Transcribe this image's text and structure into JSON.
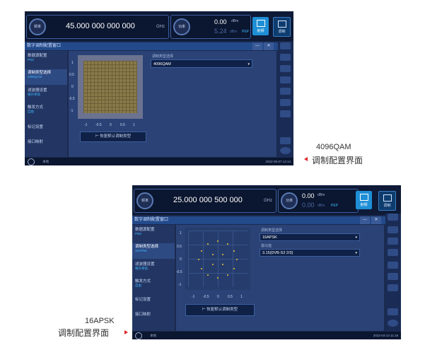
{
  "screen1": {
    "freq_knob": "频率",
    "freq_value": "45.000 000 000 000",
    "freq_unit": "GHz",
    "power_knob": "功率",
    "power_value": "0.00",
    "power_unit": "dBm",
    "power_sub_value": "5.24",
    "power_sub_unit": "dBm",
    "power_sub_tag": "PEP",
    "btn_rf": "射频",
    "btn_mod": "调制",
    "window_title": "数字调制配置窗口",
    "min_btn": "—",
    "close_btn": "✕",
    "sidebar": [
      {
        "label": "数据源配置",
        "sub": "PN9",
        "active": false
      },
      {
        "label": "调制类型选择",
        "sub": "4096QAM",
        "active": true
      },
      {
        "label": "滤波器设置",
        "sub": "根升余弦",
        "active": false
      },
      {
        "label": "触发方式",
        "sub": "自由",
        "active": false
      },
      {
        "label": "标记设置",
        "sub": "",
        "active": false
      },
      {
        "label": "接口映射",
        "sub": "",
        "active": false
      }
    ],
    "y_ticks": [
      "1",
      "0.5",
      "0",
      "-0.5",
      "-1"
    ],
    "x_ticks": [
      "-1",
      "-0.5",
      "0",
      "0.5",
      "1"
    ],
    "field_label": "调制类型选择",
    "field_value": "4096QAM",
    "restore_btn": "恢复默认调制类型",
    "status_left": "本地",
    "status_time": "2022-05-07 14:14"
  },
  "screen2": {
    "freq_knob": "频率",
    "freq_value": "25.000 000 500 000",
    "freq_unit": "GHz",
    "power_knob": "功率",
    "power_value": "0.00",
    "power_unit": "dBm",
    "power_sub_value": "0.00",
    "power_sub_unit": "dBm",
    "power_sub_tag": "PEP",
    "btn_rf": "射频",
    "btn_mod": "调制",
    "window_title": "数字调制配置窗口",
    "min_btn": "—",
    "close_btn": "✕",
    "sidebar": [
      {
        "label": "数据源配置",
        "sub": "PN9",
        "active": false
      },
      {
        "label": "调制类型选择",
        "sub": "16APSK",
        "active": true
      },
      {
        "label": "滤波器设置",
        "sub": "根升余弦",
        "active": false
      },
      {
        "label": "触发方式",
        "sub": "自由",
        "active": false
      },
      {
        "label": "标记设置",
        "sub": "",
        "active": false
      },
      {
        "label": "接口映射",
        "sub": "",
        "active": false
      }
    ],
    "y_ticks": [
      "1",
      "0.5",
      "0",
      "-0.5",
      "-1"
    ],
    "x_ticks": [
      "-1",
      "-0.5",
      "0",
      "0.5",
      "1"
    ],
    "field_label": "调制类型选择",
    "field_value": "16APSK",
    "field2_label": "伽马值",
    "field2_value": "3.15(DVB-S2 2/3)",
    "restore_btn": "恢复默认调制类型",
    "status_left": "本地",
    "status_time": "2022-04-13 11:18"
  },
  "captions": {
    "c1_line1": "4096QAM",
    "c1_line2": "调制配置界面",
    "c2_line1": "16APSK",
    "c2_line2": "调制配置界面"
  },
  "colors": {
    "accent": "#1e8fd6",
    "dot": "#f2c531",
    "arrow": "#e0262b"
  }
}
